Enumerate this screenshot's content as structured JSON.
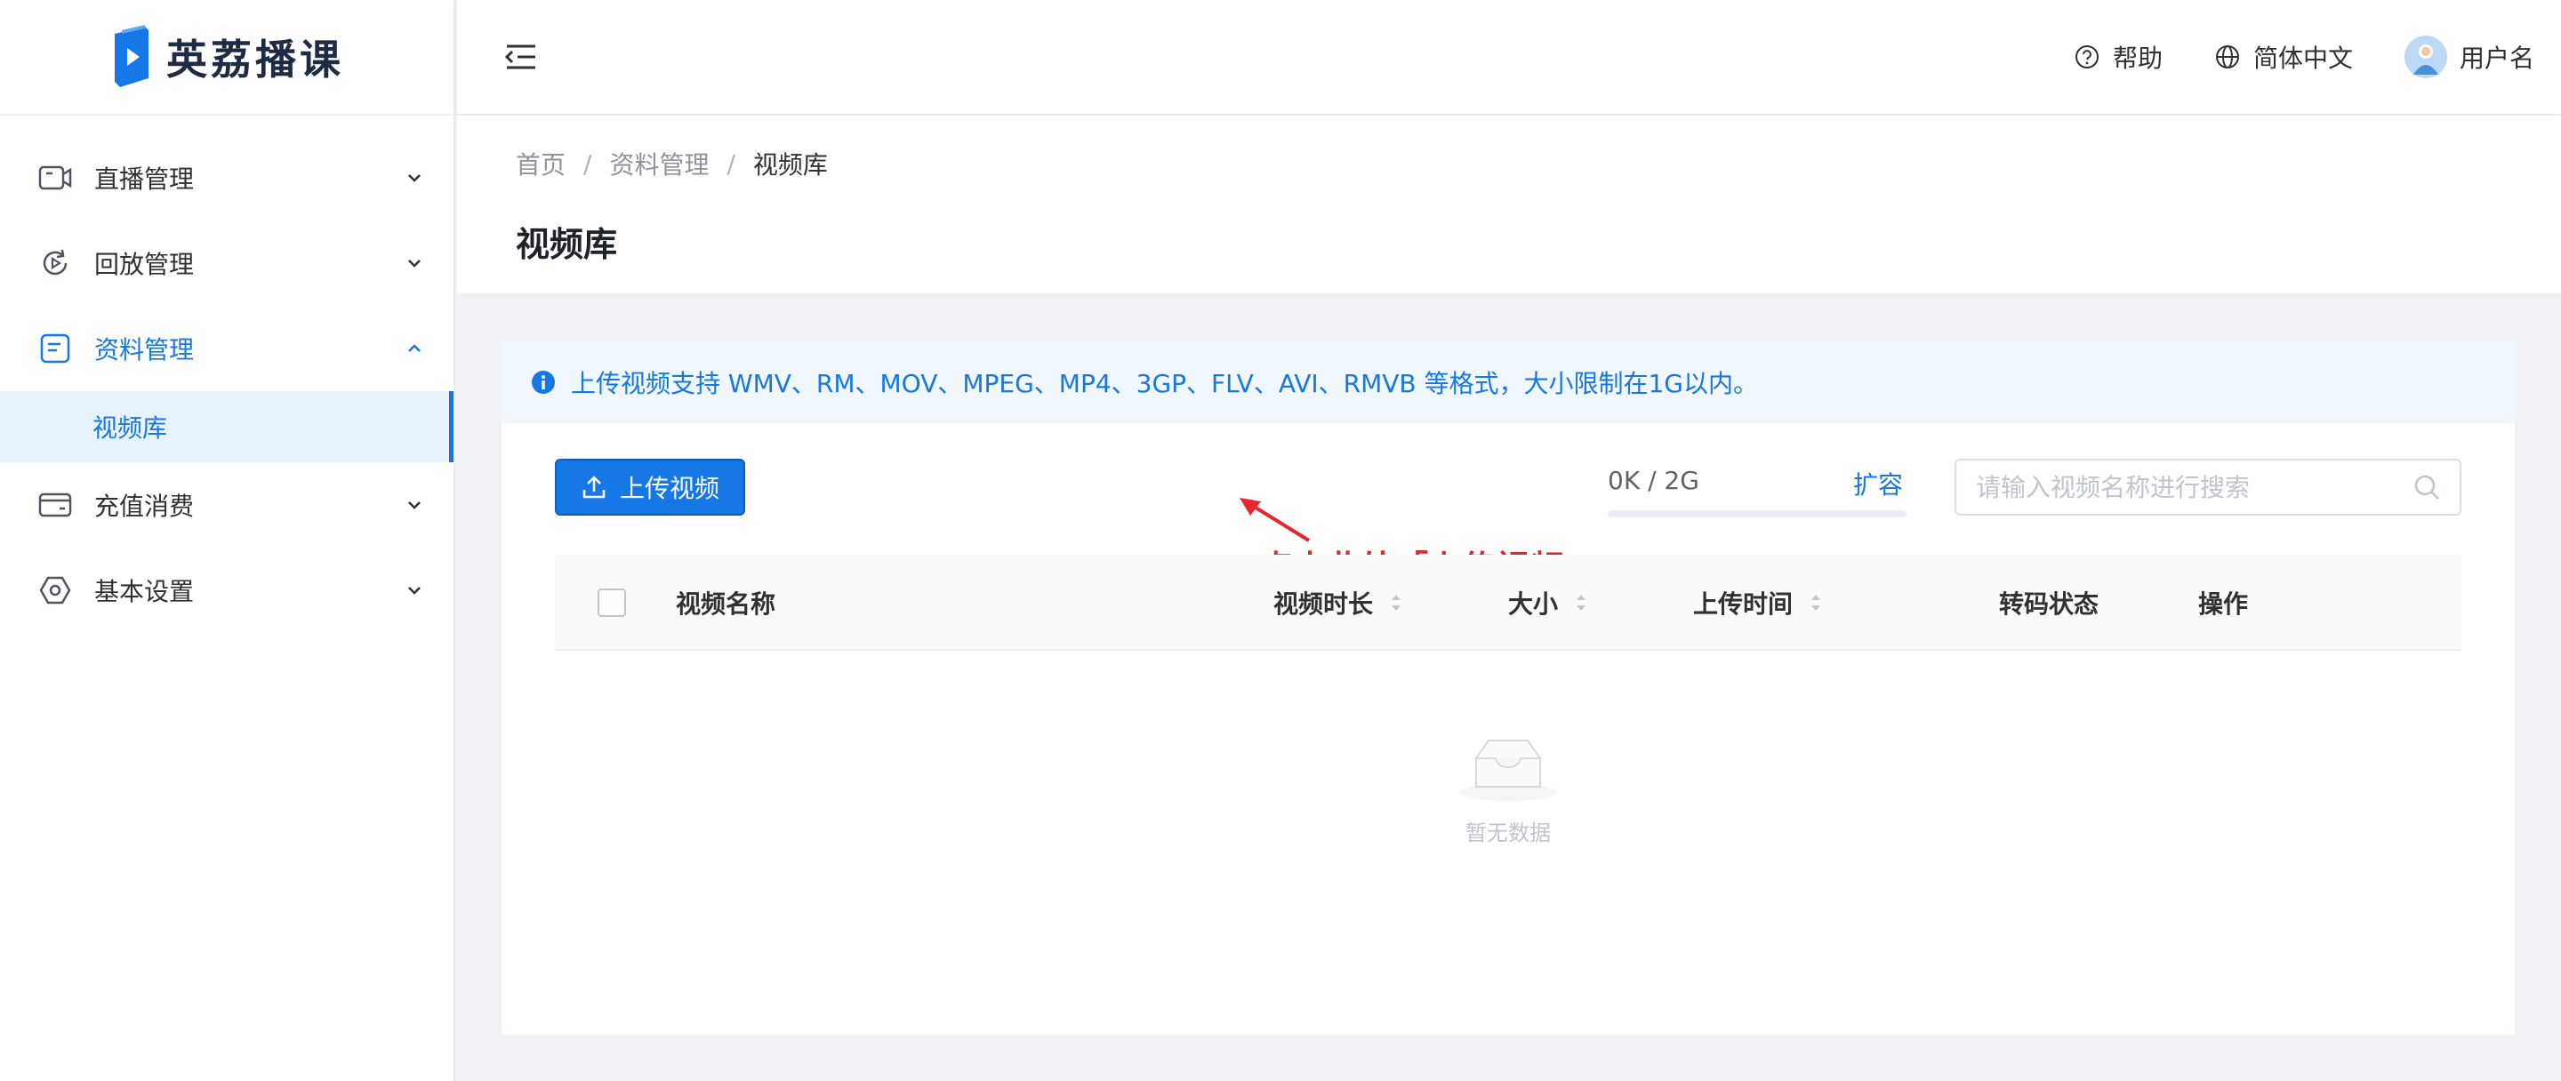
{
  "app": {
    "name": "英荔播课",
    "colors": {
      "primary": "#1677e6",
      "annotation": "#e8262d",
      "page_bg": "#f0f2f5"
    }
  },
  "sidebar": {
    "items": [
      {
        "label": "直播管理",
        "icon": "video-camera-icon",
        "expanded": false
      },
      {
        "label": "回放管理",
        "icon": "replay-icon",
        "expanded": false
      },
      {
        "label": "资料管理",
        "icon": "document-icon",
        "expanded": true,
        "children": [
          {
            "label": "视频库",
            "selected": true
          }
        ]
      },
      {
        "label": "充值消费",
        "icon": "wallet-icon",
        "expanded": false
      },
      {
        "label": "基本设置",
        "icon": "settings-icon",
        "expanded": false
      }
    ]
  },
  "header": {
    "help": "帮助",
    "language": "简体中文",
    "username": "用户名"
  },
  "breadcrumb": [
    "首页",
    "资料管理",
    "视频库"
  ],
  "page_title": "视频库",
  "notice": "上传视频支持 WMV、RM、MOV、MPEG、MP4、3GP、FLV、AVI、RMVB 等格式，大小限制在1G以内。",
  "toolbar": {
    "upload_label": "上传视频",
    "storage_text": "0K / 2G",
    "storage_used_fraction": 0,
    "expand_label": "扩容",
    "search_placeholder": "请输入视频名称进行搜索"
  },
  "annotation": "点击此处「上传视频」",
  "table": {
    "columns": [
      "视频名称",
      "视频时长",
      "大小",
      "上传时间",
      "转码状态",
      "操作"
    ],
    "rows": [],
    "empty_text": "暂无数据"
  }
}
